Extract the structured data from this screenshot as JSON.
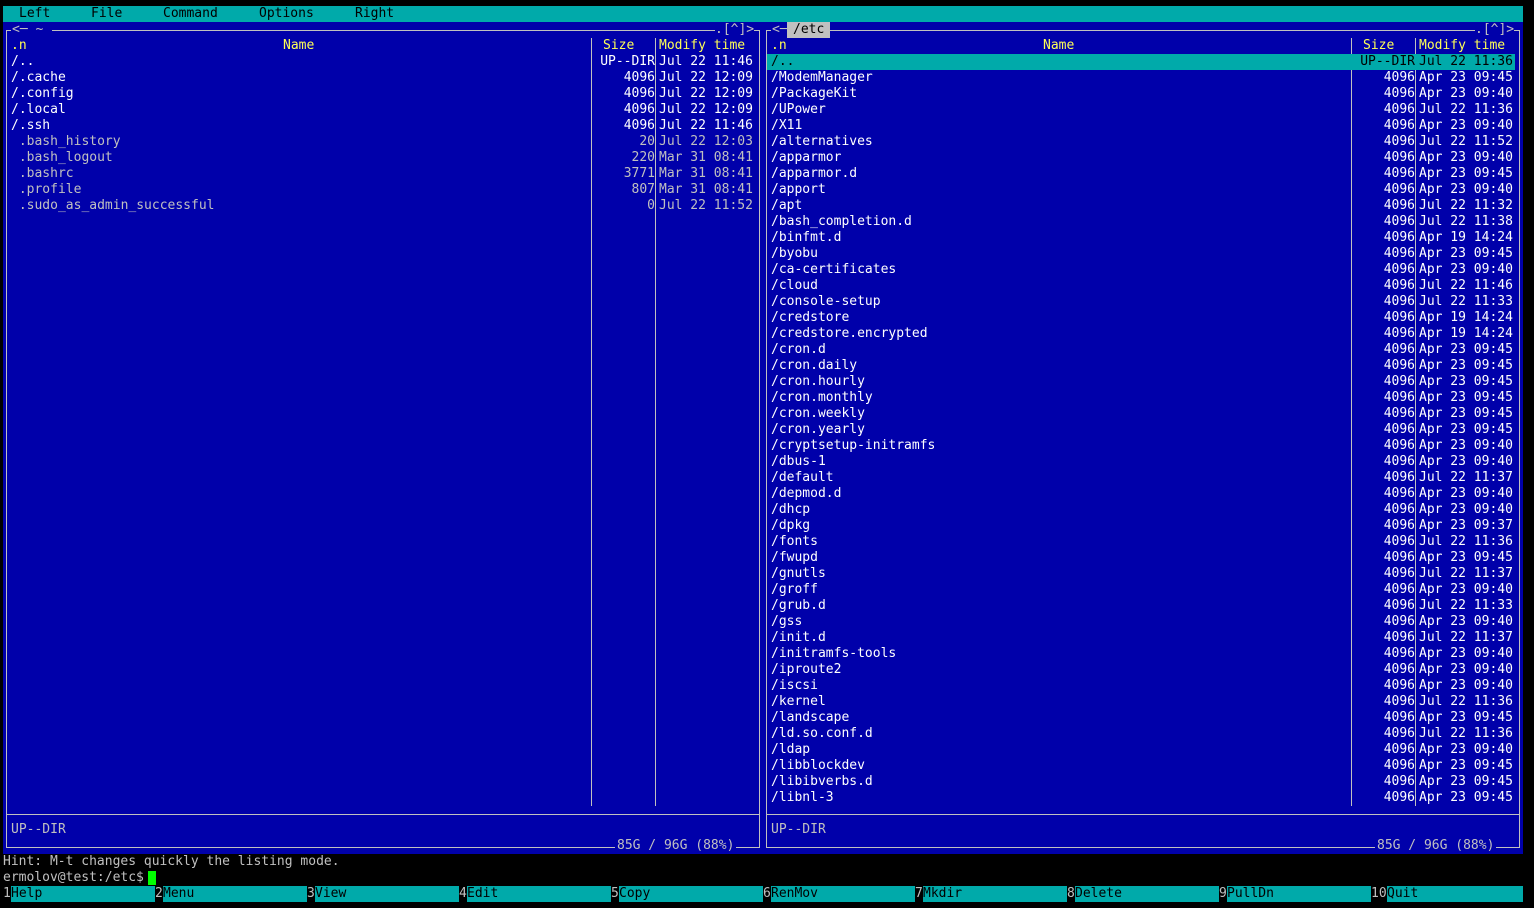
{
  "menu": {
    "items": [
      {
        "label": "Left"
      },
      {
        "label": "File"
      },
      {
        "label": "Command"
      },
      {
        "label": "Options"
      },
      {
        "label": "Right"
      }
    ]
  },
  "left_panel": {
    "title_left": "<─ ~ ",
    "title_right": ".[^]>",
    "headers": {
      "n": ".n",
      "name": "Name",
      "size": "Size",
      "mtime": "Modify time"
    },
    "rows": [
      {
        "name": "/..",
        "size": "UP--DIR",
        "mtime": "Jul 22 11:46",
        "kind": "dir"
      },
      {
        "name": "/.cache",
        "size": "4096",
        "mtime": "Jul 22 12:09",
        "kind": "dir"
      },
      {
        "name": "/.config",
        "size": "4096",
        "mtime": "Jul 22 12:09",
        "kind": "dir"
      },
      {
        "name": "/.local",
        "size": "4096",
        "mtime": "Jul 22 12:09",
        "kind": "dir"
      },
      {
        "name": "/.ssh",
        "size": "4096",
        "mtime": "Jul 22 11:46",
        "kind": "dir"
      },
      {
        "name": " .bash_history",
        "size": "20",
        "mtime": "Jul 22 12:03",
        "kind": "file"
      },
      {
        "name": " .bash_logout",
        "size": "220",
        "mtime": "Mar 31 08:41",
        "kind": "file"
      },
      {
        "name": " .bashrc",
        "size": "3771",
        "mtime": "Mar 31 08:41",
        "kind": "file"
      },
      {
        "name": " .profile",
        "size": "807",
        "mtime": "Mar 31 08:41",
        "kind": "file"
      },
      {
        "name": " .sudo_as_admin_successful",
        "size": "0",
        "mtime": "Jul 22 11:52",
        "kind": "file"
      }
    ],
    "status": "UP--DIR",
    "free_space": "85G / 96G (88%)"
  },
  "right_panel": {
    "title_left": "<─",
    "title_path": "/etc",
    "title_right": ".[^]>",
    "headers": {
      "n": ".n",
      "name": "Name",
      "size": "Size",
      "mtime": "Modify time"
    },
    "rows": [
      {
        "name": "/..",
        "size": "UP--DIR",
        "mtime": "Jul 22 11:36",
        "kind": "sel"
      },
      {
        "name": "/ModemManager",
        "size": "4096",
        "mtime": "Apr 23 09:45",
        "kind": "dir"
      },
      {
        "name": "/PackageKit",
        "size": "4096",
        "mtime": "Apr 23 09:40",
        "kind": "dir"
      },
      {
        "name": "/UPower",
        "size": "4096",
        "mtime": "Jul 22 11:36",
        "kind": "dir"
      },
      {
        "name": "/X11",
        "size": "4096",
        "mtime": "Apr 23 09:40",
        "kind": "dir"
      },
      {
        "name": "/alternatives",
        "size": "4096",
        "mtime": "Jul 22 11:52",
        "kind": "dir"
      },
      {
        "name": "/apparmor",
        "size": "4096",
        "mtime": "Apr 23 09:40",
        "kind": "dir"
      },
      {
        "name": "/apparmor.d",
        "size": "4096",
        "mtime": "Apr 23 09:45",
        "kind": "dir"
      },
      {
        "name": "/apport",
        "size": "4096",
        "mtime": "Apr 23 09:40",
        "kind": "dir"
      },
      {
        "name": "/apt",
        "size": "4096",
        "mtime": "Jul 22 11:32",
        "kind": "dir"
      },
      {
        "name": "/bash_completion.d",
        "size": "4096",
        "mtime": "Jul 22 11:38",
        "kind": "dir"
      },
      {
        "name": "/binfmt.d",
        "size": "4096",
        "mtime": "Apr 19 14:24",
        "kind": "dir"
      },
      {
        "name": "/byobu",
        "size": "4096",
        "mtime": "Apr 23 09:45",
        "kind": "dir"
      },
      {
        "name": "/ca-certificates",
        "size": "4096",
        "mtime": "Apr 23 09:40",
        "kind": "dir"
      },
      {
        "name": "/cloud",
        "size": "4096",
        "mtime": "Jul 22 11:46",
        "kind": "dir"
      },
      {
        "name": "/console-setup",
        "size": "4096",
        "mtime": "Jul 22 11:33",
        "kind": "dir"
      },
      {
        "name": "/credstore",
        "size": "4096",
        "mtime": "Apr 19 14:24",
        "kind": "dir"
      },
      {
        "name": "/credstore.encrypted",
        "size": "4096",
        "mtime": "Apr 19 14:24",
        "kind": "dir"
      },
      {
        "name": "/cron.d",
        "size": "4096",
        "mtime": "Apr 23 09:45",
        "kind": "dir"
      },
      {
        "name": "/cron.daily",
        "size": "4096",
        "mtime": "Apr 23 09:45",
        "kind": "dir"
      },
      {
        "name": "/cron.hourly",
        "size": "4096",
        "mtime": "Apr 23 09:45",
        "kind": "dir"
      },
      {
        "name": "/cron.monthly",
        "size": "4096",
        "mtime": "Apr 23 09:45",
        "kind": "dir"
      },
      {
        "name": "/cron.weekly",
        "size": "4096",
        "mtime": "Apr 23 09:45",
        "kind": "dir"
      },
      {
        "name": "/cron.yearly",
        "size": "4096",
        "mtime": "Apr 23 09:45",
        "kind": "dir"
      },
      {
        "name": "/cryptsetup-initramfs",
        "size": "4096",
        "mtime": "Apr 23 09:40",
        "kind": "dir"
      },
      {
        "name": "/dbus-1",
        "size": "4096",
        "mtime": "Apr 23 09:40",
        "kind": "dir"
      },
      {
        "name": "/default",
        "size": "4096",
        "mtime": "Jul 22 11:37",
        "kind": "dir"
      },
      {
        "name": "/depmod.d",
        "size": "4096",
        "mtime": "Apr 23 09:40",
        "kind": "dir"
      },
      {
        "name": "/dhcp",
        "size": "4096",
        "mtime": "Apr 23 09:40",
        "kind": "dir"
      },
      {
        "name": "/dpkg",
        "size": "4096",
        "mtime": "Apr 23 09:37",
        "kind": "dir"
      },
      {
        "name": "/fonts",
        "size": "4096",
        "mtime": "Jul 22 11:36",
        "kind": "dir"
      },
      {
        "name": "/fwupd",
        "size": "4096",
        "mtime": "Apr 23 09:45",
        "kind": "dir"
      },
      {
        "name": "/gnutls",
        "size": "4096",
        "mtime": "Jul 22 11:37",
        "kind": "dir"
      },
      {
        "name": "/groff",
        "size": "4096",
        "mtime": "Apr 23 09:40",
        "kind": "dir"
      },
      {
        "name": "/grub.d",
        "size": "4096",
        "mtime": "Jul 22 11:33",
        "kind": "dir"
      },
      {
        "name": "/gss",
        "size": "4096",
        "mtime": "Apr 23 09:40",
        "kind": "dir"
      },
      {
        "name": "/init.d",
        "size": "4096",
        "mtime": "Jul 22 11:37",
        "kind": "dir"
      },
      {
        "name": "/initramfs-tools",
        "size": "4096",
        "mtime": "Apr 23 09:40",
        "kind": "dir"
      },
      {
        "name": "/iproute2",
        "size": "4096",
        "mtime": "Apr 23 09:40",
        "kind": "dir"
      },
      {
        "name": "/iscsi",
        "size": "4096",
        "mtime": "Apr 23 09:40",
        "kind": "dir"
      },
      {
        "name": "/kernel",
        "size": "4096",
        "mtime": "Jul 22 11:36",
        "kind": "dir"
      },
      {
        "name": "/landscape",
        "size": "4096",
        "mtime": "Apr 23 09:45",
        "kind": "dir"
      },
      {
        "name": "/ld.so.conf.d",
        "size": "4096",
        "mtime": "Jul 22 11:36",
        "kind": "dir"
      },
      {
        "name": "/ldap",
        "size": "4096",
        "mtime": "Apr 23 09:40",
        "kind": "dir"
      },
      {
        "name": "/libblockdev",
        "size": "4096",
        "mtime": "Apr 23 09:45",
        "kind": "dir"
      },
      {
        "name": "/libibverbs.d",
        "size": "4096",
        "mtime": "Apr 23 09:45",
        "kind": "dir"
      },
      {
        "name": "/libnl-3",
        "size": "4096",
        "mtime": "Apr 23 09:45",
        "kind": "dir"
      }
    ],
    "status": "UP--DIR",
    "free_space": "85G / 96G (88%)"
  },
  "hint": "Hint: M-t changes quickly the listing mode.",
  "prompt": "ermolov@test:/etc$",
  "fkeys": [
    {
      "num": "1",
      "label": "Help"
    },
    {
      "num": "2",
      "label": "Menu"
    },
    {
      "num": "3",
      "label": "View"
    },
    {
      "num": "4",
      "label": "Edit"
    },
    {
      "num": "5",
      "label": "Copy"
    },
    {
      "num": "6",
      "label": "RenMov"
    },
    {
      "num": "7",
      "label": "Mkdir"
    },
    {
      "num": "8",
      "label": "Delete"
    },
    {
      "num": "9",
      "label": "PullDn"
    },
    {
      "num": "10",
      "label": "Quit"
    }
  ],
  "colors": {
    "panel_bg": "#0000aa",
    "bar_bg": "#00aaaa",
    "header_fg": "#ffff55",
    "dir_fg": "#ffffff",
    "file_fg": "#c0c0c0",
    "cursor": "#00ff00"
  }
}
